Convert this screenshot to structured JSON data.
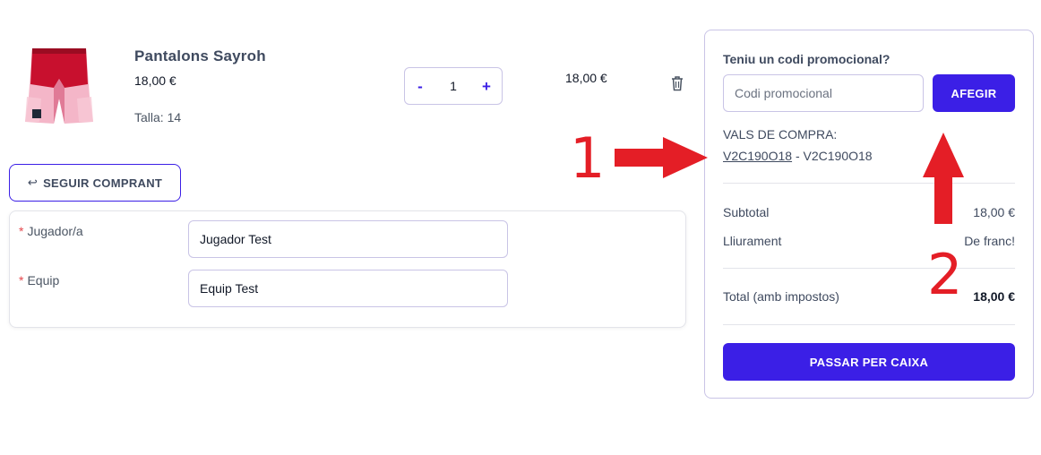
{
  "product": {
    "name": "Pantalons Sayroh",
    "price": "18,00 €",
    "size": "Talla: 14",
    "image_icon": "shorts-image",
    "quantity": "1",
    "qty_minus": "-",
    "qty_plus": "+",
    "line_total": "18,00 €",
    "delete_icon": "trash-icon"
  },
  "continue_button": {
    "icon": "return-arrow-icon",
    "icon_glyph": "↩",
    "label": "SEGUIR COMPRANT"
  },
  "form": {
    "player": {
      "required_mark": "*",
      "label": "Jugador/a",
      "value": "Jugador Test"
    },
    "team": {
      "required_mark": "*",
      "label": "Equip",
      "value": "Equip Test"
    }
  },
  "summary": {
    "promo_title": "Teniu un codi promocional?",
    "promo_placeholder": "Codi promocional",
    "add_button": "AFEGIR",
    "vouchers_title": "VALS DE COMPRA:",
    "voucher_code": "V2C190O18",
    "voucher_separator": " - ",
    "voucher_name": "V2C190O18",
    "subtotal_label": "Subtotal",
    "subtotal_value": "18,00 €",
    "shipping_label": "Lliurament",
    "shipping_value": "De franc!",
    "total_label": "Total (amb impostos)",
    "total_value": "18,00 €",
    "checkout_button": "PASSAR PER CAIXA"
  },
  "annotations": {
    "number_1": "1",
    "number_2": "2",
    "arrow_color": "#e41e26"
  },
  "colors": {
    "accent": "#3b1fe6",
    "border": "#c9c4e6",
    "required": "#e5484d"
  }
}
